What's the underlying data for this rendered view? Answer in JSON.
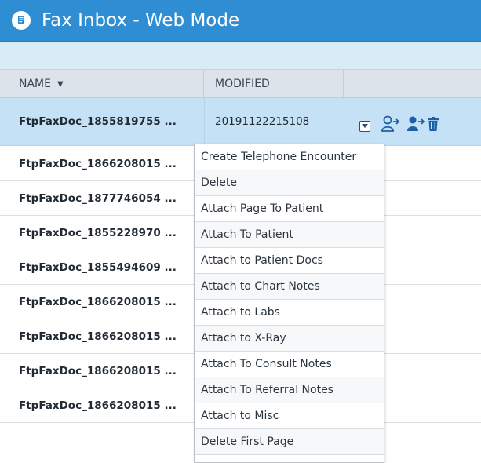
{
  "window": {
    "title": "Fax Inbox - Web Mode"
  },
  "columns": {
    "name": "NAME",
    "sort_indicator": "▼",
    "modified": "MODIFIED"
  },
  "rows": [
    {
      "name": "FtpFaxDoc_1855819755 ...",
      "modified": "20191122215108"
    },
    {
      "name": "FtpFaxDoc_1866208015 ...",
      "modified": ""
    },
    {
      "name": "FtpFaxDoc_1877746054 ...",
      "modified": ""
    },
    {
      "name": "FtpFaxDoc_1855228970 ...",
      "modified": ""
    },
    {
      "name": "FtpFaxDoc_1855494609 ...",
      "modified": ""
    },
    {
      "name": "FtpFaxDoc_1866208015 ...",
      "modified": ""
    },
    {
      "name": "FtpFaxDoc_1866208015 ...",
      "modified": ""
    },
    {
      "name": "FtpFaxDoc_1866208015 ...",
      "modified": ""
    },
    {
      "name": "FtpFaxDoc_1866208015 ...",
      "modified": ""
    }
  ],
  "row_actions": {
    "icons": [
      "dropdown-toggle-icon",
      "assign-user-icon",
      "forward-user-icon",
      "trash-icon"
    ]
  },
  "context_menu": {
    "items": [
      "Create Telephone Encounter",
      "Delete",
      "Attach Page To Patient",
      "Attach To Patient",
      "Attach to Patient Docs",
      "Attach to Chart Notes",
      "Attach to Labs",
      "Attach to X-Ray",
      "Attach To Consult Notes",
      "Attach To Referral Notes",
      "Attach to Misc",
      "Delete First Page"
    ]
  },
  "colors": {
    "titlebar": "#2f8ed3",
    "subbar": "#d8ecf8",
    "selected_row": "#c5e1f6",
    "icon_blue": "#1f5fa8"
  }
}
